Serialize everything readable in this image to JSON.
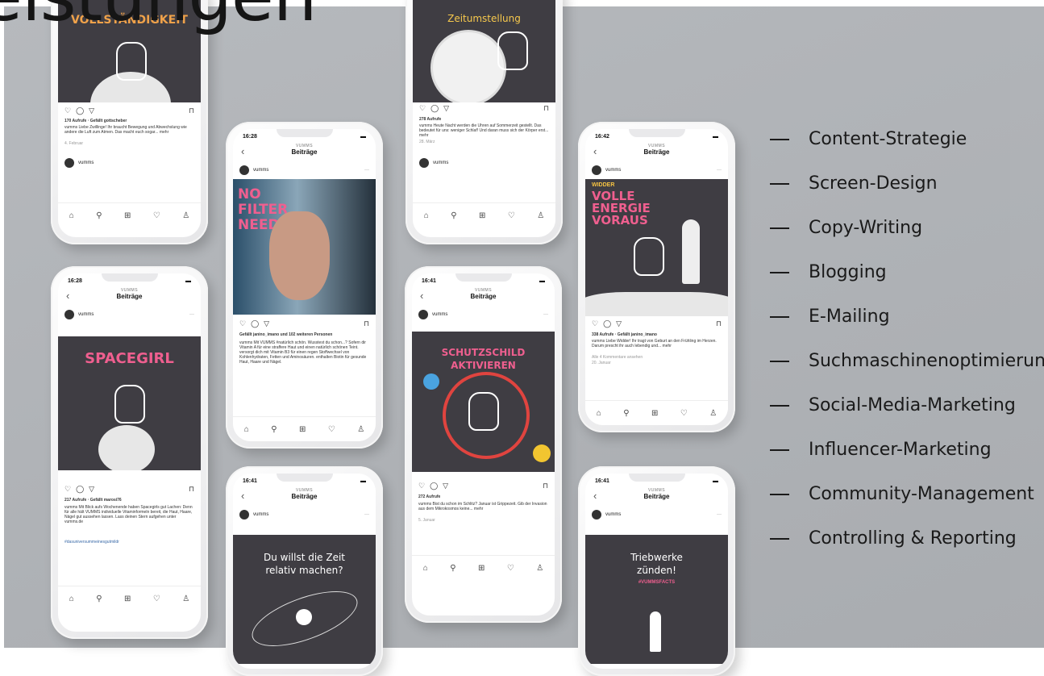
{
  "headline": "eistungen",
  "services": [
    "Content-Strategie",
    "Screen-Design",
    "Copy-Writing",
    "Blogging",
    "E-Mailing",
    "Suchmaschinenoptimierung",
    "Social-Media-Marketing",
    "Influencer-Marketing",
    "Community-Management",
    "Controlling & Reporting"
  ],
  "phones": {
    "p1": {
      "post_text": "VOLLSTÄNDIGKEIT",
      "likes": "170 Aufrufe · Gefällt gottscheber",
      "caption": "vumms Liebe Zwillinge! Ihr braucht Bewegung und Abwechslung wie andere die Luft zum Atmen. Das macht euch sogar... mehr",
      "date": "4. Februar",
      "account": "vumms"
    },
    "p2": {
      "post_text": "Zeitumstellung",
      "likes": "278 Aufrufe",
      "caption": "vumms Heute Nacht werden die Uhren auf Sommerzeit gestellt. Das bedeutet für uns: weniger Schlaf! Und daran muss sich der Körper erst... mehr",
      "date": "28. März",
      "account": "vumms"
    },
    "p3": {
      "time": "16:28",
      "header_sup": "VUMMS",
      "header": "Beiträge",
      "account": "vumms",
      "post_text": "NO FILTER NEEDED",
      "likes": "Gefällt janino_imano und 102 weiteren Personen",
      "caption": "vumms Mit VUMMS #natürlich schön. Wusstest du schon...? Sofern dir Vitamin A für eine straffere Haut und einen natürlich schönen Teint. versorgt dich mit Vitamin B3 für einen regen Stoffwechsel von Kohlenhydraten, Fetten und Aminosäuren. enthalten Biotin für gesunde Haut, Haare und Nägel."
    },
    "p4": {
      "time": "16:42",
      "header_sup": "VUMMS",
      "header": "Beiträge",
      "account": "vumms",
      "post_tag": "WIDDER",
      "post_text": "VOLLE ENERGIE VORAUS",
      "likes": "338 Aufrufe · Gefällt janino_imano",
      "caption": "vumms Liebe Widder! Ihr tragt von Geburt an den Frühling im Herzen. Darum prescht ihr auch lebendig und... mehr",
      "comments": "Alle 4 Kommentare ansehen",
      "date": "20. Januar"
    },
    "p5": {
      "time": "16:28",
      "header_sup": "VUMMS",
      "header": "Beiträge",
      "account": "vumms",
      "post_text": "SPACEGIRL",
      "likes": "217 Aufrufe · Gefällt marosi76",
      "caption": "vumms Mit Blick aufs Wochenende haben Spacegirls gut Lachen: Denn für alle hält VUMMS individuelle Vitaminformeln bereit, die Haut, Haare, Nägel gut aussehen lassen. Lass deinen Stern aufgehen unter vumms.de",
      "hashtag": "#dasuniversummeinesgutmildr"
    },
    "p6": {
      "time": "16:41",
      "header_sup": "VUMMS",
      "header": "Beiträge",
      "account": "vumms",
      "post_text": "SCHUTZSCHILD AKTIVIEREN",
      "likes": "272 Aufrufe",
      "caption": "vumms Bist du schon im Schlitz? Januar ist Grippezeit. Gib der Invasion aus dem Mikrokosmos keine... mehr",
      "date": "5. Januar"
    },
    "p7": {
      "time": "16:41",
      "header_sup": "VUMMS",
      "header": "Beiträge",
      "account": "vumms",
      "post_text": "Du willst die Zeit relativ machen?"
    },
    "p8": {
      "time": "16:41",
      "header_sup": "VUMMS",
      "header": "Beiträge",
      "account": "vumms",
      "post_text": "Triebwerke zünden!",
      "post_tag": "#VUMMSFACTS"
    }
  }
}
